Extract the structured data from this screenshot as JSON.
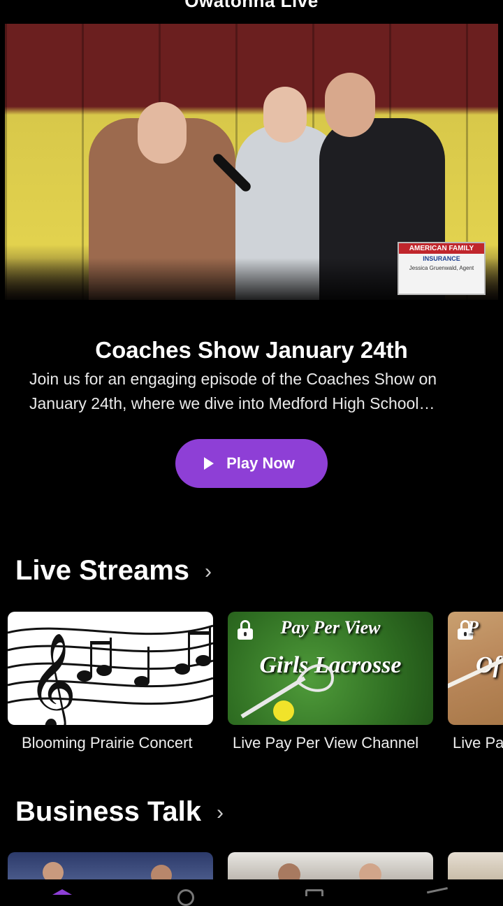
{
  "app": {
    "title": "Owatonna Live"
  },
  "hero": {
    "ad_brand": "AMERICAN FAMILY",
    "ad_sub": "INSURANCE",
    "ad_agent": "Jessica Gruenwald, Agent"
  },
  "feature": {
    "title": "Coaches Show January 24th",
    "description": "Join us for an engaging episode of the Coaches Show on January 24th, where we dive into Medford High School athletics and more.",
    "play_label": "Play Now"
  },
  "sections": {
    "live_streams": {
      "label": "Live Streams",
      "cards": [
        {
          "title": "Blooming Prairie Concert",
          "locked": false
        },
        {
          "title": "Live Pay Per View Channel",
          "locked": true,
          "line1": "Pay Per View",
          "line2": "Girls Lacrosse"
        },
        {
          "title": "Live Pay Per View",
          "locked": true,
          "line1": "P",
          "line2": "Of"
        }
      ]
    },
    "business_talk": {
      "label": "Business Talk"
    }
  },
  "colors": {
    "accent": "#8e3fd6",
    "background": "#000000"
  }
}
